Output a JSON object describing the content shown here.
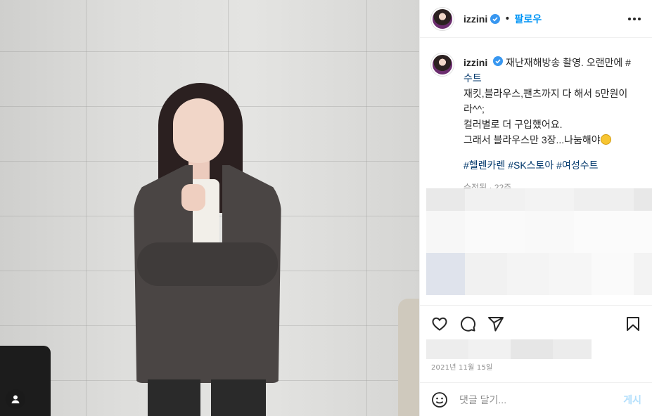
{
  "post": {
    "username": "izzini",
    "follow_label": "팔로우",
    "separator": "•",
    "caption_lines": [
      "재난재해방송 촬영. 오랜만에 #",
      "수트",
      "재킷,블라우스,팬츠까지 다 해서 5만원이",
      "라^^;",
      "컬러별로 더 구입했어요.",
      "그래서 블라우스만 3장...나눔해야"
    ],
    "hashtags": "#헬렌카렌 #SK스토아 #여성수트",
    "meta": "수정됨 · 22주",
    "date": "2021년 11월 15일",
    "comment_placeholder": "댓글 달기...",
    "post_label": "게시"
  },
  "colors": {
    "accent": "#0095f6",
    "verified": "#3897f0",
    "hashtag": "#00376b",
    "muted": "#8e8e8e",
    "post_disabled": "#b2dffc"
  },
  "icons": {
    "verified": "verified-badge-icon",
    "more": "more-options-icon",
    "heart": "heart-icon",
    "comment": "comment-icon",
    "share": "share-icon",
    "save": "bookmark-icon",
    "emoji": "smiley-icon",
    "user": "user-tag-icon"
  }
}
